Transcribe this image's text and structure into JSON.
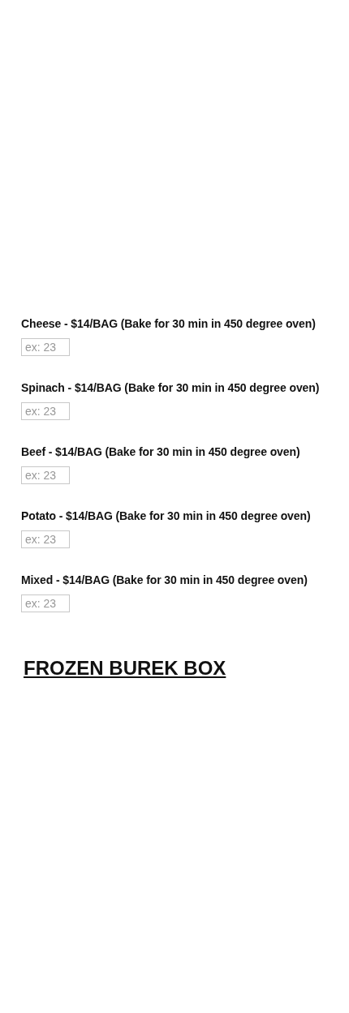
{
  "items": [
    {
      "label": "Cheese - $14/BAG (Bake for 30 min in 450 degree oven)",
      "placeholder": "ex: 23"
    },
    {
      "label": "Spinach - $14/BAG (Bake for 30 min in 450 degree oven)",
      "placeholder": "ex: 23"
    },
    {
      "label": "Beef - $14/BAG (Bake for 30 min in 450 degree oven)",
      "placeholder": "ex: 23"
    },
    {
      "label": "Potato - $14/BAG (Bake for 30 min in 450 degree oven)",
      "placeholder": "ex: 23"
    },
    {
      "label": "Mixed - $14/BAG (Bake for 30 min in 450 degree oven)",
      "placeholder": "ex: 23"
    }
  ],
  "heading": "FROZEN BUREK BOX"
}
